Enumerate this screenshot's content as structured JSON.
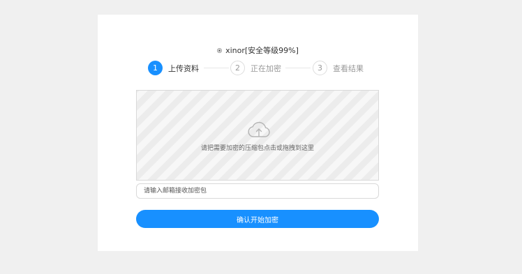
{
  "algorithm": {
    "label": "xinor[安全等级99%]",
    "selected": true
  },
  "steps": [
    {
      "number": "1",
      "label": "上传资料",
      "state": "active"
    },
    {
      "number": "2",
      "label": "正在加密",
      "state": "inactive"
    },
    {
      "number": "3",
      "label": "查看结果",
      "state": "inactive"
    }
  ],
  "upload": {
    "icon": "cloud-upload-icon",
    "hint": "请把需要加密的压缩包点击或拖拽到这里"
  },
  "email": {
    "value": "",
    "placeholder": "请输入邮箱接收加密包"
  },
  "confirm_button": {
    "label": "确认开始加密"
  },
  "colors": {
    "accent": "#1890ff",
    "page_background": "#f0f0f0",
    "card_background": "#ffffff"
  }
}
